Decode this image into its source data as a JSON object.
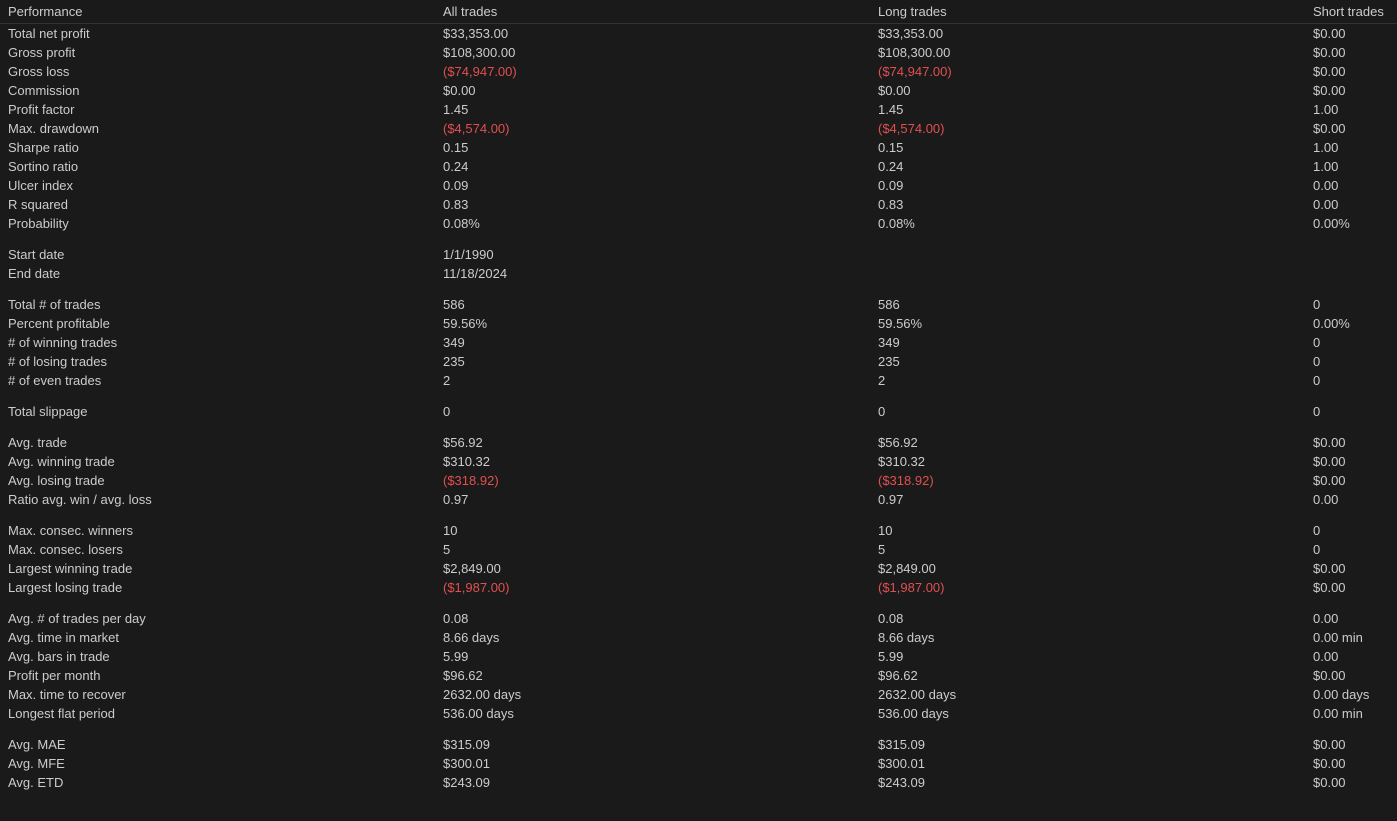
{
  "header": {
    "performance": "Performance",
    "all_trades": "All trades",
    "long_trades": "Long trades",
    "short_trades": "Short trades"
  },
  "rows": [
    {
      "label": "Total net profit",
      "all": "$33,353.00",
      "long": "$33,353.00",
      "short": "$0.00",
      "negative_all": false,
      "negative_long": false,
      "negative_short": false
    },
    {
      "label": "Gross profit",
      "all": "$108,300.00",
      "long": "$108,300.00",
      "short": "$0.00",
      "negative_all": false,
      "negative_long": false,
      "negative_short": false
    },
    {
      "label": "Gross loss",
      "all": "($74,947.00)",
      "long": "($74,947.00)",
      "short": "$0.00",
      "negative_all": true,
      "negative_long": true,
      "negative_short": false
    },
    {
      "label": "Commission",
      "all": "$0.00",
      "long": "$0.00",
      "short": "$0.00",
      "negative_all": false,
      "negative_long": false,
      "negative_short": false
    },
    {
      "label": "Profit factor",
      "all": "1.45",
      "long": "1.45",
      "short": "1.00",
      "negative_all": false,
      "negative_long": false,
      "negative_short": false
    },
    {
      "label": "Max. drawdown",
      "all": "($4,574.00)",
      "long": "($4,574.00)",
      "short": "$0.00",
      "negative_all": true,
      "negative_long": true,
      "negative_short": false
    },
    {
      "label": "Sharpe ratio",
      "all": "0.15",
      "long": "0.15",
      "short": "1.00",
      "negative_all": false,
      "negative_long": false,
      "negative_short": false
    },
    {
      "label": "Sortino ratio",
      "all": "0.24",
      "long": "0.24",
      "short": "1.00",
      "negative_all": false,
      "negative_long": false,
      "negative_short": false
    },
    {
      "label": "Ulcer index",
      "all": "0.09",
      "long": "0.09",
      "short": "0.00",
      "negative_all": false,
      "negative_long": false,
      "negative_short": false
    },
    {
      "label": "R squared",
      "all": "0.83",
      "long": "0.83",
      "short": "0.00",
      "negative_all": false,
      "negative_long": false,
      "negative_short": false
    },
    {
      "label": "Probability",
      "all": "0.08%",
      "long": "0.08%",
      "short": "0.00%",
      "negative_all": false,
      "negative_long": false,
      "negative_short": false
    },
    {
      "label": "Start date",
      "all": "1/1/1990",
      "long": "",
      "short": "",
      "negative_all": false,
      "negative_long": false,
      "negative_short": false,
      "spacer_before": true
    },
    {
      "label": "End date",
      "all": "11/18/2024",
      "long": "",
      "short": "",
      "negative_all": false,
      "negative_long": false,
      "negative_short": false
    },
    {
      "label": "Total # of trades",
      "all": "586",
      "long": "586",
      "short": "0",
      "negative_all": false,
      "negative_long": false,
      "negative_short": false,
      "spacer_before": true
    },
    {
      "label": "Percent profitable",
      "all": "59.56%",
      "long": "59.56%",
      "short": "0.00%",
      "negative_all": false,
      "negative_long": false,
      "negative_short": false
    },
    {
      "label": "# of winning trades",
      "all": "349",
      "long": "349",
      "short": "0",
      "negative_all": false,
      "negative_long": false,
      "negative_short": false
    },
    {
      "label": "# of losing trades",
      "all": "235",
      "long": "235",
      "short": "0",
      "negative_all": false,
      "negative_long": false,
      "negative_short": false
    },
    {
      "label": "# of even trades",
      "all": "2",
      "long": "2",
      "short": "0",
      "negative_all": false,
      "negative_long": false,
      "negative_short": false
    },
    {
      "label": "Total slippage",
      "all": "0",
      "long": "0",
      "short": "0",
      "negative_all": false,
      "negative_long": false,
      "negative_short": false,
      "spacer_before": true
    },
    {
      "label": "Avg. trade",
      "all": "$56.92",
      "long": "$56.92",
      "short": "$0.00",
      "negative_all": false,
      "negative_long": false,
      "negative_short": false,
      "spacer_before": true
    },
    {
      "label": "Avg. winning trade",
      "all": "$310.32",
      "long": "$310.32",
      "short": "$0.00",
      "negative_all": false,
      "negative_long": false,
      "negative_short": false
    },
    {
      "label": "Avg. losing trade",
      "all": "($318.92)",
      "long": "($318.92)",
      "short": "$0.00",
      "negative_all": true,
      "negative_long": true,
      "negative_short": false
    },
    {
      "label": "Ratio avg. win / avg. loss",
      "all": "0.97",
      "long": "0.97",
      "short": "0.00",
      "negative_all": false,
      "negative_long": false,
      "negative_short": false
    },
    {
      "label": "Max. consec. winners",
      "all": "10",
      "long": "10",
      "short": "0",
      "negative_all": false,
      "negative_long": false,
      "negative_short": false,
      "spacer_before": true
    },
    {
      "label": "Max. consec. losers",
      "all": "5",
      "long": "5",
      "short": "0",
      "negative_all": false,
      "negative_long": false,
      "negative_short": false
    },
    {
      "label": "Largest winning trade",
      "all": "$2,849.00",
      "long": "$2,849.00",
      "short": "$0.00",
      "negative_all": false,
      "negative_long": false,
      "negative_short": false
    },
    {
      "label": "Largest losing trade",
      "all": "($1,987.00)",
      "long": "($1,987.00)",
      "short": "$0.00",
      "negative_all": true,
      "negative_long": true,
      "negative_short": false
    },
    {
      "label": "Avg. # of trades per day",
      "all": "0.08",
      "long": "0.08",
      "short": "0.00",
      "negative_all": false,
      "negative_long": false,
      "negative_short": false,
      "spacer_before": true
    },
    {
      "label": "Avg. time in market",
      "all": "8.66 days",
      "long": "8.66 days",
      "short": "0.00 min",
      "negative_all": false,
      "negative_long": false,
      "negative_short": false
    },
    {
      "label": "Avg. bars in trade",
      "all": "5.99",
      "long": "5.99",
      "short": "0.00",
      "negative_all": false,
      "negative_long": false,
      "negative_short": false
    },
    {
      "label": "Profit per month",
      "all": "$96.62",
      "long": "$96.62",
      "short": "$0.00",
      "negative_all": false,
      "negative_long": false,
      "negative_short": false
    },
    {
      "label": "Max. time to recover",
      "all": "2632.00 days",
      "long": "2632.00 days",
      "short": "0.00 days",
      "negative_all": false,
      "negative_long": false,
      "negative_short": false
    },
    {
      "label": "Longest flat period",
      "all": "536.00 days",
      "long": "536.00 days",
      "short": "0.00 min",
      "negative_all": false,
      "negative_long": false,
      "negative_short": false
    },
    {
      "label": "Avg. MAE",
      "all": "$315.09",
      "long": "$315.09",
      "short": "$0.00",
      "negative_all": false,
      "negative_long": false,
      "negative_short": false,
      "spacer_before": true
    },
    {
      "label": "Avg. MFE",
      "all": "$300.01",
      "long": "$300.01",
      "short": "$0.00",
      "negative_all": false,
      "negative_long": false,
      "negative_short": false
    },
    {
      "label": "Avg. ETD",
      "all": "$243.09",
      "long": "$243.09",
      "short": "$0.00",
      "negative_all": false,
      "negative_long": false,
      "negative_short": false
    }
  ]
}
